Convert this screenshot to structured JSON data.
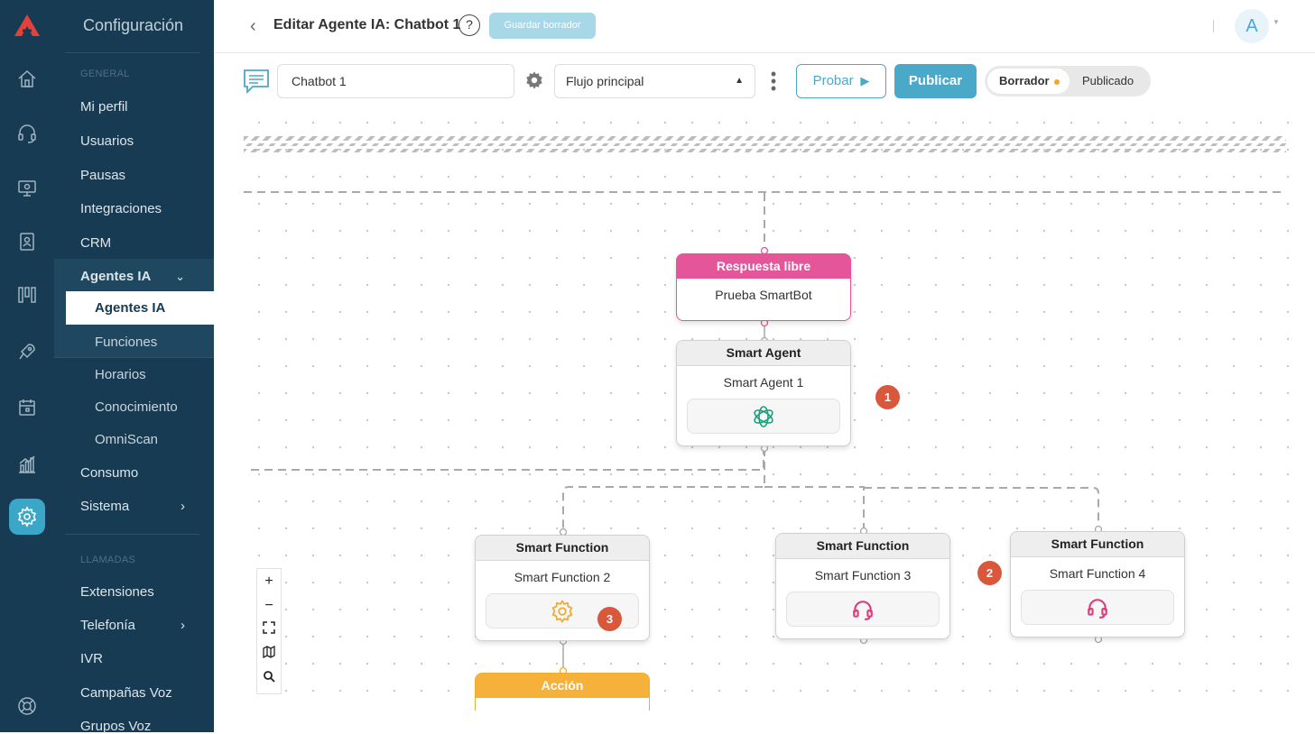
{
  "sidebar": {
    "title": "Configuración",
    "section_general": "GENERAL",
    "items_general": [
      "Mi perfil",
      "Usuarios",
      "Pausas",
      "Integraciones",
      "CRM"
    ],
    "group_label": "Agentes IA",
    "group_children": [
      "Agentes IA",
      "Funciones",
      "Horarios",
      "Conocimiento",
      "OmniScan"
    ],
    "after_group": [
      "Consumo",
      "Sistema"
    ],
    "section_calls": "LLAMADAS",
    "items_calls": [
      "Extensiones",
      "Telefonía",
      "IVR",
      "Campañas Voz",
      "Grupos Voz"
    ]
  },
  "header": {
    "title": "Editar Agente IA: Chatbot 1",
    "help": "?",
    "save_draft": "Guardar borrador",
    "avatar": "A"
  },
  "toolbar": {
    "bot_name": "Chatbot 1",
    "flow_select": "Flujo principal",
    "test_label": "Probar",
    "publish_label": "Publicar",
    "status_draft": "Borrador",
    "status_published": "Publicado"
  },
  "flow": {
    "node_free": {
      "header": "Respuesta libre",
      "body": "Prueba SmartBot"
    },
    "node_agent": {
      "header": "Smart Agent",
      "body": "Smart Agent 1"
    },
    "node_f2": {
      "header": "Smart Function",
      "body": "Smart Function 2"
    },
    "node_f3": {
      "header": "Smart Function",
      "body": "Smart Function 3"
    },
    "node_f4": {
      "header": "Smart Function",
      "body": "Smart Function 4"
    },
    "node_action": {
      "header": "Acción"
    },
    "badges": [
      "1",
      "2",
      "3"
    ]
  },
  "zoom_controls": [
    "+",
    "−"
  ],
  "colors": {
    "sidebar_bg": "#173b52",
    "accent": "#4aa8c8",
    "free_response": "#e5559a",
    "action": "#f5b13a",
    "badge": "#d9573b"
  }
}
